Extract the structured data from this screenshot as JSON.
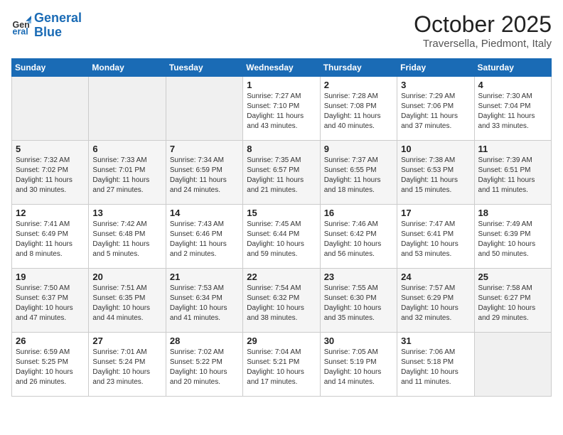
{
  "header": {
    "logo_line1": "General",
    "logo_line2": "Blue",
    "title": "October 2025",
    "subtitle": "Traversella, Piedmont, Italy"
  },
  "weekdays": [
    "Sunday",
    "Monday",
    "Tuesday",
    "Wednesday",
    "Thursday",
    "Friday",
    "Saturday"
  ],
  "weeks": [
    [
      {
        "day": "",
        "empty": true
      },
      {
        "day": "",
        "empty": true
      },
      {
        "day": "",
        "empty": true
      },
      {
        "day": "1",
        "sunrise": "7:27 AM",
        "sunset": "7:10 PM",
        "daylight": "11 hours and 43 minutes."
      },
      {
        "day": "2",
        "sunrise": "7:28 AM",
        "sunset": "7:08 PM",
        "daylight": "11 hours and 40 minutes."
      },
      {
        "day": "3",
        "sunrise": "7:29 AM",
        "sunset": "7:06 PM",
        "daylight": "11 hours and 37 minutes."
      },
      {
        "day": "4",
        "sunrise": "7:30 AM",
        "sunset": "7:04 PM",
        "daylight": "11 hours and 33 minutes."
      }
    ],
    [
      {
        "day": "5",
        "sunrise": "7:32 AM",
        "sunset": "7:02 PM",
        "daylight": "11 hours and 30 minutes."
      },
      {
        "day": "6",
        "sunrise": "7:33 AM",
        "sunset": "7:01 PM",
        "daylight": "11 hours and 27 minutes."
      },
      {
        "day": "7",
        "sunrise": "7:34 AM",
        "sunset": "6:59 PM",
        "daylight": "11 hours and 24 minutes."
      },
      {
        "day": "8",
        "sunrise": "7:35 AM",
        "sunset": "6:57 PM",
        "daylight": "11 hours and 21 minutes."
      },
      {
        "day": "9",
        "sunrise": "7:37 AM",
        "sunset": "6:55 PM",
        "daylight": "11 hours and 18 minutes."
      },
      {
        "day": "10",
        "sunrise": "7:38 AM",
        "sunset": "6:53 PM",
        "daylight": "11 hours and 15 minutes."
      },
      {
        "day": "11",
        "sunrise": "7:39 AM",
        "sunset": "6:51 PM",
        "daylight": "11 hours and 11 minutes."
      }
    ],
    [
      {
        "day": "12",
        "sunrise": "7:41 AM",
        "sunset": "6:49 PM",
        "daylight": "11 hours and 8 minutes."
      },
      {
        "day": "13",
        "sunrise": "7:42 AM",
        "sunset": "6:48 PM",
        "daylight": "11 hours and 5 minutes."
      },
      {
        "day": "14",
        "sunrise": "7:43 AM",
        "sunset": "6:46 PM",
        "daylight": "11 hours and 2 minutes."
      },
      {
        "day": "15",
        "sunrise": "7:45 AM",
        "sunset": "6:44 PM",
        "daylight": "10 hours and 59 minutes."
      },
      {
        "day": "16",
        "sunrise": "7:46 AM",
        "sunset": "6:42 PM",
        "daylight": "10 hours and 56 minutes."
      },
      {
        "day": "17",
        "sunrise": "7:47 AM",
        "sunset": "6:41 PM",
        "daylight": "10 hours and 53 minutes."
      },
      {
        "day": "18",
        "sunrise": "7:49 AM",
        "sunset": "6:39 PM",
        "daylight": "10 hours and 50 minutes."
      }
    ],
    [
      {
        "day": "19",
        "sunrise": "7:50 AM",
        "sunset": "6:37 PM",
        "daylight": "10 hours and 47 minutes."
      },
      {
        "day": "20",
        "sunrise": "7:51 AM",
        "sunset": "6:35 PM",
        "daylight": "10 hours and 44 minutes."
      },
      {
        "day": "21",
        "sunrise": "7:53 AM",
        "sunset": "6:34 PM",
        "daylight": "10 hours and 41 minutes."
      },
      {
        "day": "22",
        "sunrise": "7:54 AM",
        "sunset": "6:32 PM",
        "daylight": "10 hours and 38 minutes."
      },
      {
        "day": "23",
        "sunrise": "7:55 AM",
        "sunset": "6:30 PM",
        "daylight": "10 hours and 35 minutes."
      },
      {
        "day": "24",
        "sunrise": "7:57 AM",
        "sunset": "6:29 PM",
        "daylight": "10 hours and 32 minutes."
      },
      {
        "day": "25",
        "sunrise": "7:58 AM",
        "sunset": "6:27 PM",
        "daylight": "10 hours and 29 minutes."
      }
    ],
    [
      {
        "day": "26",
        "sunrise": "6:59 AM",
        "sunset": "5:25 PM",
        "daylight": "10 hours and 26 minutes."
      },
      {
        "day": "27",
        "sunrise": "7:01 AM",
        "sunset": "5:24 PM",
        "daylight": "10 hours and 23 minutes."
      },
      {
        "day": "28",
        "sunrise": "7:02 AM",
        "sunset": "5:22 PM",
        "daylight": "10 hours and 20 minutes."
      },
      {
        "day": "29",
        "sunrise": "7:04 AM",
        "sunset": "5:21 PM",
        "daylight": "10 hours and 17 minutes."
      },
      {
        "day": "30",
        "sunrise": "7:05 AM",
        "sunset": "5:19 PM",
        "daylight": "10 hours and 14 minutes."
      },
      {
        "day": "31",
        "sunrise": "7:06 AM",
        "sunset": "5:18 PM",
        "daylight": "10 hours and 11 minutes."
      },
      {
        "day": "",
        "empty": true
      }
    ]
  ]
}
